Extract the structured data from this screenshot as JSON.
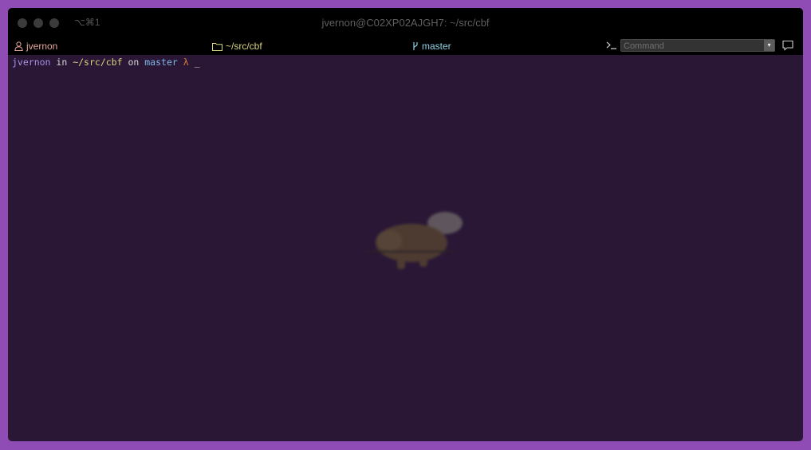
{
  "window": {
    "shortcut": "⌥⌘1",
    "title": "jvernon@C02XP02AJGH7: ~/src/cbf"
  },
  "status_bar": {
    "user": "jvernon",
    "directory": "~/src/cbf",
    "branch": "master",
    "command_placeholder": "Command"
  },
  "prompt": {
    "user": "jvernon",
    "in_word": "in",
    "directory": "~/src/cbf",
    "on_word": "on",
    "branch": "master",
    "symbol": "λ",
    "cursor": "_"
  },
  "icons": [
    "user-icon",
    "folder-icon",
    "git-branch-icon",
    "terminal-icon",
    "speech-bubble-icon",
    "chevron-down-icon"
  ],
  "colors": {
    "frame": "#8e4cb4",
    "terminal_bg": "#2a1736",
    "user": "#e5a59b",
    "directory": "#d8d57f",
    "branch": "#8fd2e6"
  }
}
